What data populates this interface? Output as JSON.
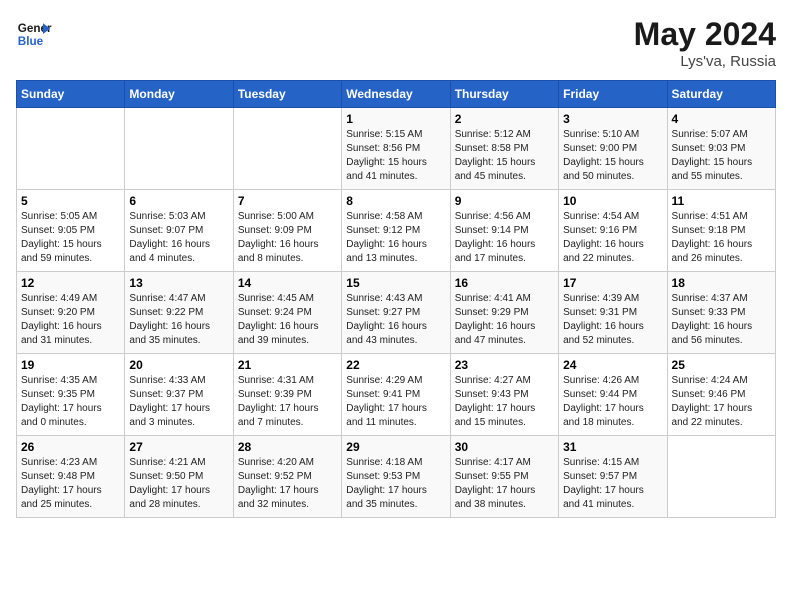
{
  "header": {
    "logo_line1": "General",
    "logo_line2": "Blue",
    "title": "May 2024",
    "subtitle": "Lys'va, Russia"
  },
  "weekdays": [
    "Sunday",
    "Monday",
    "Tuesday",
    "Wednesday",
    "Thursday",
    "Friday",
    "Saturday"
  ],
  "weeks": [
    [
      {
        "day": "",
        "info": ""
      },
      {
        "day": "",
        "info": ""
      },
      {
        "day": "",
        "info": ""
      },
      {
        "day": "1",
        "info": "Sunrise: 5:15 AM\nSunset: 8:56 PM\nDaylight: 15 hours\nand 41 minutes."
      },
      {
        "day": "2",
        "info": "Sunrise: 5:12 AM\nSunset: 8:58 PM\nDaylight: 15 hours\nand 45 minutes."
      },
      {
        "day": "3",
        "info": "Sunrise: 5:10 AM\nSunset: 9:00 PM\nDaylight: 15 hours\nand 50 minutes."
      },
      {
        "day": "4",
        "info": "Sunrise: 5:07 AM\nSunset: 9:03 PM\nDaylight: 15 hours\nand 55 minutes."
      }
    ],
    [
      {
        "day": "5",
        "info": "Sunrise: 5:05 AM\nSunset: 9:05 PM\nDaylight: 15 hours\nand 59 minutes."
      },
      {
        "day": "6",
        "info": "Sunrise: 5:03 AM\nSunset: 9:07 PM\nDaylight: 16 hours\nand 4 minutes."
      },
      {
        "day": "7",
        "info": "Sunrise: 5:00 AM\nSunset: 9:09 PM\nDaylight: 16 hours\nand 8 minutes."
      },
      {
        "day": "8",
        "info": "Sunrise: 4:58 AM\nSunset: 9:12 PM\nDaylight: 16 hours\nand 13 minutes."
      },
      {
        "day": "9",
        "info": "Sunrise: 4:56 AM\nSunset: 9:14 PM\nDaylight: 16 hours\nand 17 minutes."
      },
      {
        "day": "10",
        "info": "Sunrise: 4:54 AM\nSunset: 9:16 PM\nDaylight: 16 hours\nand 22 minutes."
      },
      {
        "day": "11",
        "info": "Sunrise: 4:51 AM\nSunset: 9:18 PM\nDaylight: 16 hours\nand 26 minutes."
      }
    ],
    [
      {
        "day": "12",
        "info": "Sunrise: 4:49 AM\nSunset: 9:20 PM\nDaylight: 16 hours\nand 31 minutes."
      },
      {
        "day": "13",
        "info": "Sunrise: 4:47 AM\nSunset: 9:22 PM\nDaylight: 16 hours\nand 35 minutes."
      },
      {
        "day": "14",
        "info": "Sunrise: 4:45 AM\nSunset: 9:24 PM\nDaylight: 16 hours\nand 39 minutes."
      },
      {
        "day": "15",
        "info": "Sunrise: 4:43 AM\nSunset: 9:27 PM\nDaylight: 16 hours\nand 43 minutes."
      },
      {
        "day": "16",
        "info": "Sunrise: 4:41 AM\nSunset: 9:29 PM\nDaylight: 16 hours\nand 47 minutes."
      },
      {
        "day": "17",
        "info": "Sunrise: 4:39 AM\nSunset: 9:31 PM\nDaylight: 16 hours\nand 52 minutes."
      },
      {
        "day": "18",
        "info": "Sunrise: 4:37 AM\nSunset: 9:33 PM\nDaylight: 16 hours\nand 56 minutes."
      }
    ],
    [
      {
        "day": "19",
        "info": "Sunrise: 4:35 AM\nSunset: 9:35 PM\nDaylight: 17 hours\nand 0 minutes."
      },
      {
        "day": "20",
        "info": "Sunrise: 4:33 AM\nSunset: 9:37 PM\nDaylight: 17 hours\nand 3 minutes."
      },
      {
        "day": "21",
        "info": "Sunrise: 4:31 AM\nSunset: 9:39 PM\nDaylight: 17 hours\nand 7 minutes."
      },
      {
        "day": "22",
        "info": "Sunrise: 4:29 AM\nSunset: 9:41 PM\nDaylight: 17 hours\nand 11 minutes."
      },
      {
        "day": "23",
        "info": "Sunrise: 4:27 AM\nSunset: 9:43 PM\nDaylight: 17 hours\nand 15 minutes."
      },
      {
        "day": "24",
        "info": "Sunrise: 4:26 AM\nSunset: 9:44 PM\nDaylight: 17 hours\nand 18 minutes."
      },
      {
        "day": "25",
        "info": "Sunrise: 4:24 AM\nSunset: 9:46 PM\nDaylight: 17 hours\nand 22 minutes."
      }
    ],
    [
      {
        "day": "26",
        "info": "Sunrise: 4:23 AM\nSunset: 9:48 PM\nDaylight: 17 hours\nand 25 minutes."
      },
      {
        "day": "27",
        "info": "Sunrise: 4:21 AM\nSunset: 9:50 PM\nDaylight: 17 hours\nand 28 minutes."
      },
      {
        "day": "28",
        "info": "Sunrise: 4:20 AM\nSunset: 9:52 PM\nDaylight: 17 hours\nand 32 minutes."
      },
      {
        "day": "29",
        "info": "Sunrise: 4:18 AM\nSunset: 9:53 PM\nDaylight: 17 hours\nand 35 minutes."
      },
      {
        "day": "30",
        "info": "Sunrise: 4:17 AM\nSunset: 9:55 PM\nDaylight: 17 hours\nand 38 minutes."
      },
      {
        "day": "31",
        "info": "Sunrise: 4:15 AM\nSunset: 9:57 PM\nDaylight: 17 hours\nand 41 minutes."
      },
      {
        "day": "",
        "info": ""
      }
    ]
  ]
}
